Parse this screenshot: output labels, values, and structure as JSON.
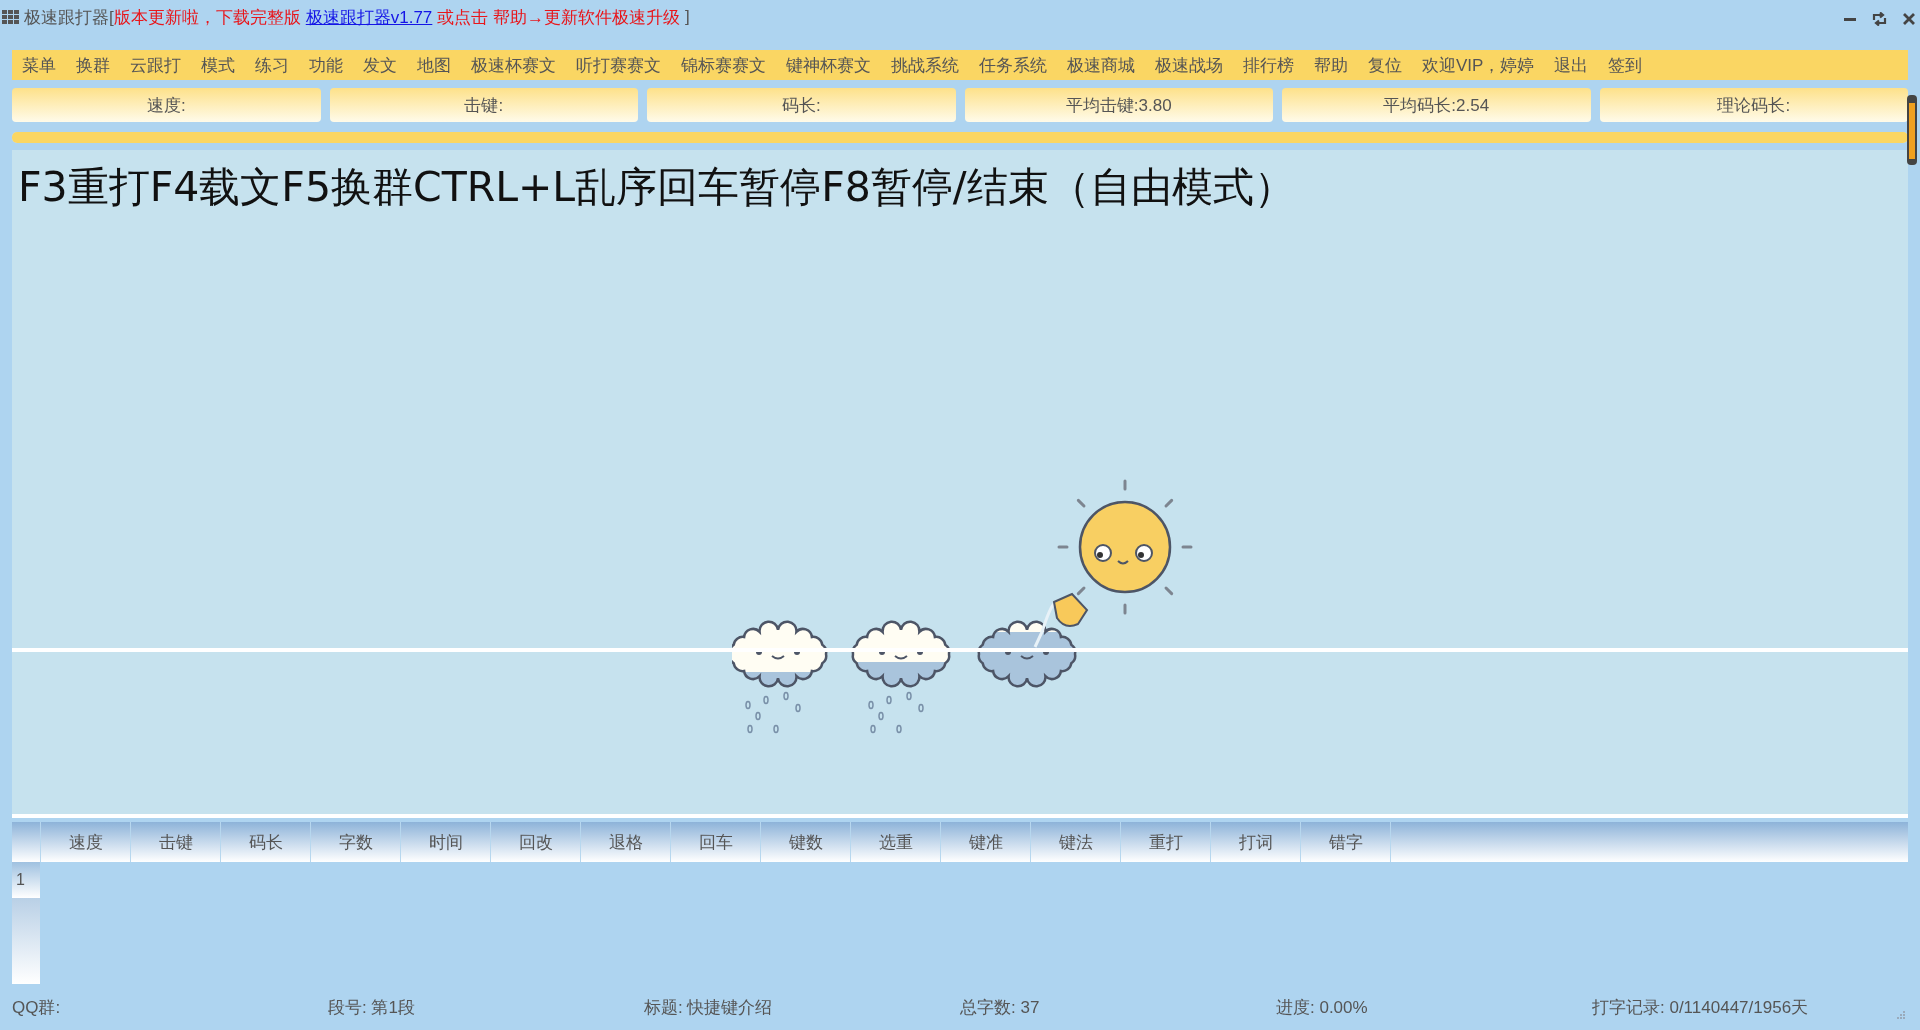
{
  "title_bar": {
    "app_name": "极速跟打器[",
    "notice": "版本更新啦，下载完整版",
    "link": "极速跟打器v1.77",
    "notice_tail": "或点击 帮助→更新软件极速升级",
    "closing": "]"
  },
  "menu": [
    "菜单",
    "换群",
    "云跟打",
    "模式",
    "练习",
    "功能",
    "发文",
    "地图",
    "极速杯赛文",
    "听打赛赛文",
    "锦标赛赛文",
    "键神杯赛文",
    "挑战系统",
    "任务系统",
    "极速商城",
    "极速战场",
    "排行榜",
    "帮助",
    "复位",
    "欢迎VIP，婷婷",
    "退出",
    "签到"
  ],
  "stats": [
    "速度:",
    "击键:",
    "码长:",
    "平均击键:3.80",
    "平均码长:2.54",
    "理论码长:"
  ],
  "progress": {
    "level": 1
  },
  "prompt_text": "F3重打F4载文F5换群CTRL+L乱序回车暂停F8暂停/结束（自由模式）",
  "results_table": {
    "columns": [
      "速度",
      "击键",
      "码长",
      "字数",
      "时间",
      "回改",
      "退格",
      "回车",
      "键数",
      "选重",
      "键准",
      "键法",
      "重打",
      "打词",
      "错字"
    ],
    "rows": [
      {
        "row_header": "1"
      }
    ]
  },
  "status_bar": [
    "QQ群:",
    "段号: 第1段",
    "标题: 快捷键介绍",
    "总字数: 37",
    "进度: 0.00%",
    "打字记录: 0/1140447/1956天"
  ]
}
